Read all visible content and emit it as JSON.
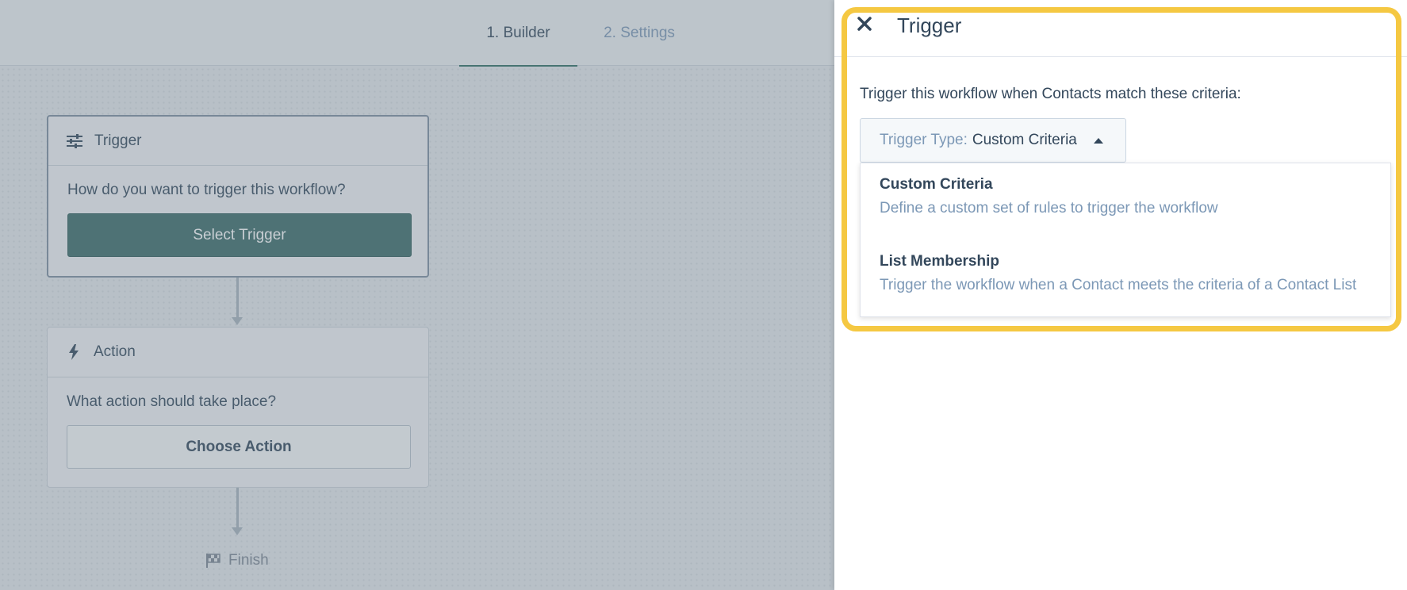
{
  "tabs": {
    "builder": "1. Builder",
    "settings": "2. Settings"
  },
  "trigger_card": {
    "title": "Trigger",
    "icon": "sliders-icon",
    "question": "How do you want to trigger this workflow?",
    "button": "Select Trigger"
  },
  "action_card": {
    "title": "Action",
    "icon": "lightning-icon",
    "question": "What action should take place?",
    "button": "Choose Action"
  },
  "finish": {
    "label": "Finish",
    "icon": "checkered-flag-icon"
  },
  "panel": {
    "title": "Trigger",
    "close_icon": "close-icon",
    "description": "Trigger this workflow when Contacts match these criteria:",
    "select": {
      "label": "Trigger Type:",
      "value": "Custom Criteria"
    },
    "options": [
      {
        "title": "Custom Criteria",
        "description": "Define a custom set of rules to trigger the workflow"
      },
      {
        "title": "List Membership",
        "description": "Trigger the workflow when a Contact meets the criteria of a Contact List"
      }
    ]
  },
  "colors": {
    "primary_button": "#3a6b68",
    "highlight": "#f5c842",
    "text": "#33475b",
    "muted_text": "#7c98b6"
  }
}
